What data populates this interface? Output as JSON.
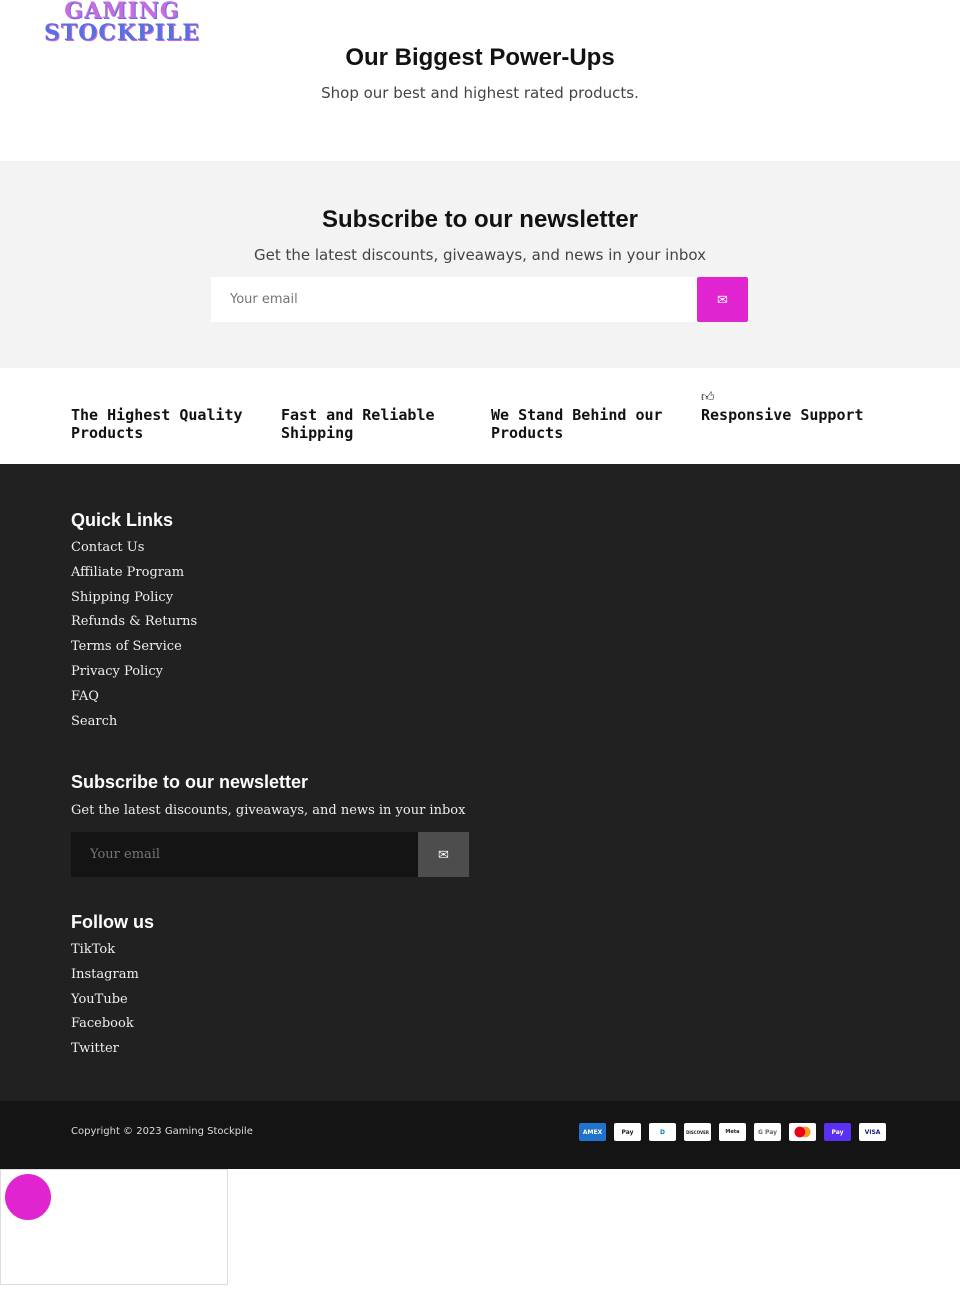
{
  "logo": {
    "line1": "GAMING",
    "line2": "STOCKPILE"
  },
  "hero": {
    "title": "Our Biggest Power-Ups",
    "subtitle": "Shop our best and highest rated products."
  },
  "newsletter": {
    "title": "Subscribe to our newsletter",
    "subtitle": "Get the latest discounts, giveaways, and news in your inbox",
    "placeholder": "Your email",
    "accent": "#e024d0"
  },
  "features": [
    "The Highest Quality Products",
    "Fast and Reliable Shipping",
    "We Stand Behind our Products",
    "Responsive Support"
  ],
  "footer": {
    "quick_links_title": "Quick Links",
    "quick_links": [
      "Contact Us",
      "Affiliate Program",
      "Shipping Policy",
      "Refunds & Returns",
      "Terms of Service",
      "Privacy Policy",
      "FAQ",
      "Search"
    ],
    "newsletter_title": "Subscribe to our newsletter",
    "newsletter_text": "Get the latest discounts, giveaways, and news in your inbox",
    "placeholder": "Your email",
    "follow_title": "Follow us",
    "social": [
      "TikTok",
      "Instagram",
      "YouTube",
      "Facebook",
      "Twitter"
    ]
  },
  "bottom": {
    "copyright": "Copyright © 2023 Gaming Stockpile",
    "payments": [
      "AMEX",
      "Pay",
      "D",
      "DISCOVER",
      "Meta",
      "G Pay",
      "MC",
      "Pay",
      "VISA"
    ]
  }
}
